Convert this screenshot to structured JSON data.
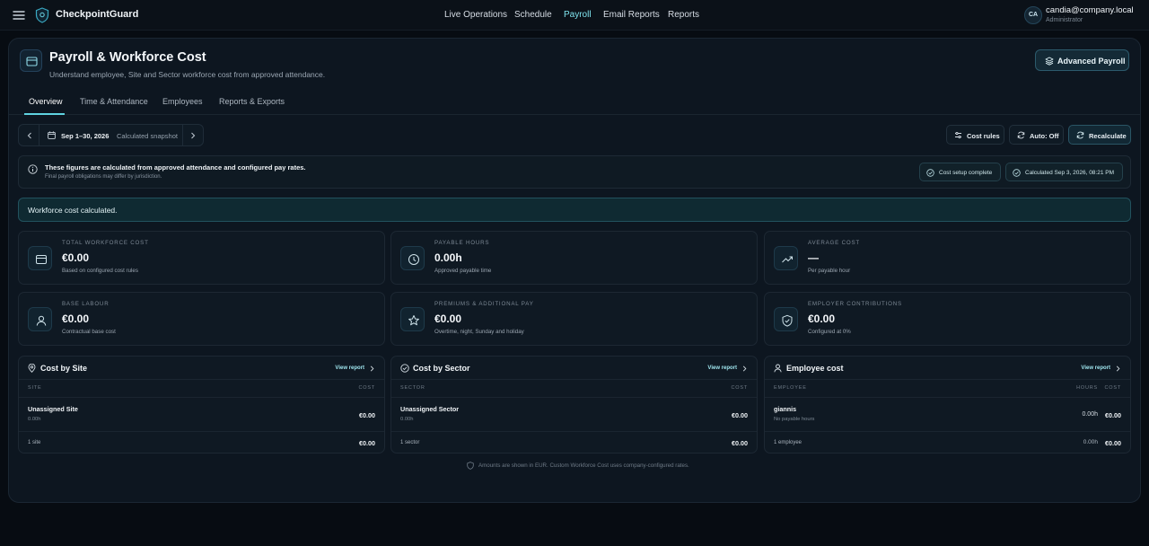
{
  "app": {
    "brand": "CheckpointGuard"
  },
  "nav": {
    "items": [
      "Live Operations",
      "Schedule",
      "Payroll",
      "Email Reports",
      "Reports"
    ],
    "active": "Payroll"
  },
  "user": {
    "initials": "CA",
    "email": "candia@company.local",
    "role": "Administrator"
  },
  "page": {
    "title": "Payroll & Workforce Cost",
    "subtitle": "Understand employee, Site and Sector workforce cost from approved attendance.",
    "advanced_button": "Advanced Payroll"
  },
  "tabs": [
    "Overview",
    "Time & Attendance",
    "Employees",
    "Reports & Exports"
  ],
  "period": {
    "range": "Sep 1–30, 2026",
    "mode": "Calculated snapshot"
  },
  "toolbar": {
    "cost_rules": "Cost rules",
    "auto": "Auto: Off",
    "recalculate": "Recalculate"
  },
  "info": {
    "title": "These figures are calculated from approved attendance and configured pay rates.",
    "note": "Final payroll obligations may differ by jurisdiction.",
    "setup_status": "Cost setup complete",
    "calculated_at": "Calculated Sep 3, 2026, 08:21 PM"
  },
  "calc_message": "Workforce cost calculated.",
  "kpis": [
    {
      "label": "TOTAL WORKFORCE COST",
      "value": "€0.00",
      "desc": "Based on configured cost rules",
      "icon": "wallet-icon"
    },
    {
      "label": "PAYABLE HOURS",
      "value": "0.00h",
      "desc": "Approved payable time",
      "icon": "clock-icon"
    },
    {
      "label": "AVERAGE COST",
      "value": "—",
      "desc": "Per payable hour",
      "icon": "trending-up-icon"
    },
    {
      "label": "BASE LABOUR",
      "value": "€0.00",
      "desc": "Contractual base cost",
      "icon": "user-icon"
    },
    {
      "label": "PREMIUMS & ADDITIONAL PAY",
      "value": "€0.00",
      "desc": "Overtime, night, Sunday and holiday",
      "icon": "star-icon"
    },
    {
      "label": "EMPLOYER CONTRIBUTIONS",
      "value": "€0.00",
      "desc": "Configured at 0%",
      "icon": "shield-check-icon"
    }
  ],
  "tables": {
    "site": {
      "title": "Cost by Site",
      "link": "View report",
      "col1": "SITE",
      "col2": "COST",
      "row": {
        "name": "Unassigned Site",
        "sub": "0.00h",
        "amount": "€0.00"
      },
      "footer": {
        "label": "1 site",
        "amount": "€0.00"
      }
    },
    "sector": {
      "title": "Cost by Sector",
      "link": "View report",
      "col1": "SECTOR",
      "col2": "COST",
      "row": {
        "name": "Unassigned Sector",
        "sub": "0.00h",
        "amount": "€0.00"
      },
      "footer": {
        "label": "1 sector",
        "amount": "€0.00"
      }
    },
    "employee": {
      "title": "Employee cost",
      "link": "View report",
      "col1": "EMPLOYEE",
      "col_hours": "HOURS",
      "col2": "COST",
      "row": {
        "name": "giannis",
        "sub": "No payable hours",
        "hours": "0.00h",
        "amount": "€0.00"
      },
      "footer": {
        "label": "1 employee",
        "hours": "0.00h",
        "amount": "€0.00"
      }
    }
  },
  "footnote": "Amounts are shown in EUR. Custom Workforce Cost uses company-configured rates.",
  "colors": {
    "accent": "#5fd3e0",
    "background": "#070c12",
    "panel": "#0d1620"
  }
}
